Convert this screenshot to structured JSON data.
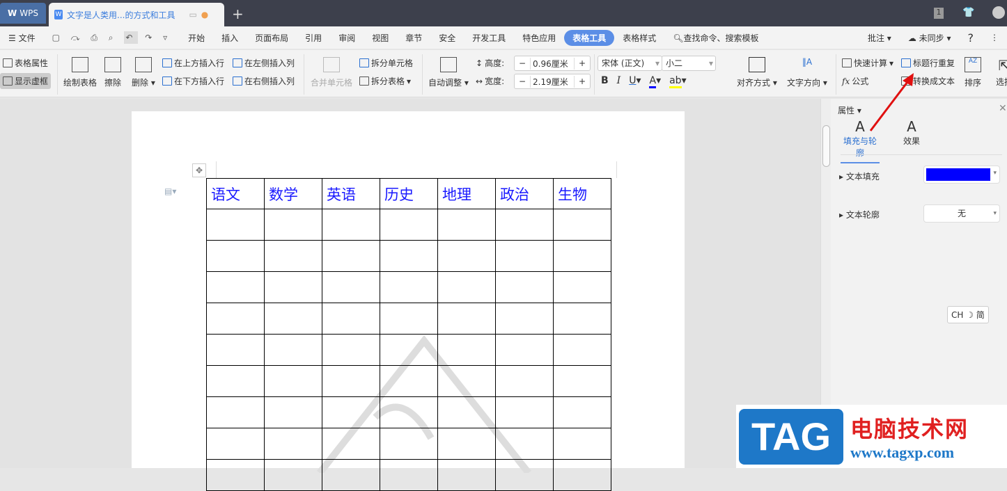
{
  "titlebar": {
    "app": "WPS",
    "doc_tab": "文字是人类用...的方式和工具",
    "badge": "1"
  },
  "menu": {
    "file": "文件",
    "items": [
      "开始",
      "插入",
      "页面布局",
      "引用",
      "审阅",
      "视图",
      "章节",
      "安全",
      "开发工具",
      "特色应用",
      "表格工具",
      "表格样式"
    ],
    "active": "表格工具",
    "search": "查找命令、搜索模板",
    "comment": "批注",
    "sync": "未同步",
    "help": "?"
  },
  "ribbon": {
    "table_props": "表格属性",
    "show_grid": "显示虚框",
    "draw_table": "绘制表格",
    "erase": "擦除",
    "delete": "删除",
    "insert_above": "在上方插入行",
    "insert_below": "在下方插入行",
    "insert_left": "在左侧插入列",
    "insert_right": "在右侧插入列",
    "merge": "合并单元格",
    "split_cell": "拆分单元格",
    "split_table": "拆分表格",
    "auto_fit": "自动调整",
    "height_label": "高度:",
    "height_value": "0.96厘米",
    "width_label": "宽度:",
    "width_value": "2.19厘米",
    "font": "宋体 (正文)",
    "size": "小二",
    "bold": "B",
    "italic": "I",
    "underline": "U",
    "fontcolor": "A",
    "highlight": "ab",
    "align": "对齐方式",
    "text_dir": "文字方向",
    "quick_calc": "快速计算",
    "formula": "公式",
    "fx": "fx",
    "repeat_header": "标题行重复",
    "to_text": "转换成文本",
    "sort": "排序",
    "select": "选择"
  },
  "table": {
    "headers": [
      "语文",
      "数学",
      "英语",
      "历史",
      "地理",
      "政治",
      "生物"
    ],
    "empty_rows": 9
  },
  "panel": {
    "title": "属性",
    "tabs": [
      "填充与轮廓",
      "效果"
    ],
    "fill_label": "文本填充",
    "fill_color": "#0000ff",
    "outline_label": "文本轮廓",
    "outline_value": "无"
  },
  "ime": "CH ☽ 简",
  "watermark": {
    "logo": "TAG",
    "site_cn": "电脑技术网",
    "site_url": "www.tagxp.com"
  }
}
